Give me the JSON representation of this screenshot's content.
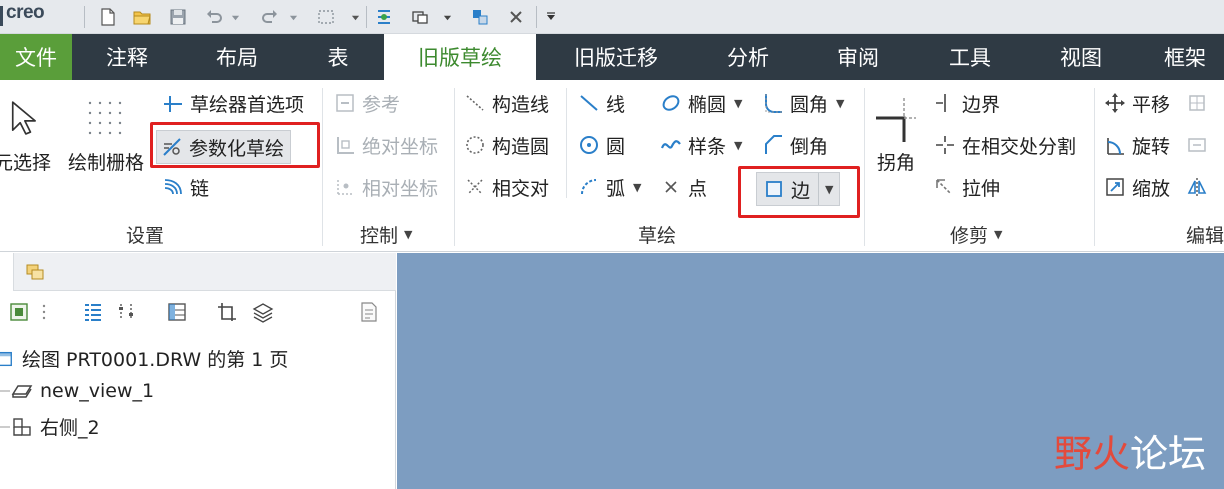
{
  "app": {
    "logo": "creo"
  },
  "tabs": [
    {
      "label": "文件"
    },
    {
      "label": "注释"
    },
    {
      "label": "布局"
    },
    {
      "label": "表"
    },
    {
      "label": "旧版草绘"
    },
    {
      "label": "旧版迁移"
    },
    {
      "label": "分析"
    },
    {
      "label": "审阅"
    },
    {
      "label": "工具"
    },
    {
      "label": "视图"
    },
    {
      "label": "框架"
    }
  ],
  "ribbon": {
    "settings": {
      "label": "设置",
      "select": "元选择",
      "grid": "绘制栅格",
      "prefs": "草绘器首选项",
      "param": "参数化草绘",
      "chain": "链"
    },
    "control": {
      "label": "控制",
      "ref": "参考",
      "abs": "绝对坐标",
      "rel": "相对坐标"
    },
    "sketch": {
      "label": "草绘",
      "cline": "构造线",
      "ccircle": "构造圆",
      "intersect": "相交对",
      "line": "线",
      "circle": "圆",
      "arc": "弧",
      "ellipse": "椭圆",
      "spline": "样条",
      "point": "点",
      "fillet": "圆角",
      "chamfer": "倒角",
      "edge": "边"
    },
    "trim": {
      "label": "修剪",
      "corner": "拐角",
      "boundary": "边界",
      "split": "在相交处分割",
      "stretch": "拉伸"
    },
    "edit": {
      "label": "编辑",
      "move": "平移",
      "rotate": "旋转",
      "scale": "缩放"
    }
  },
  "tree": {
    "root": "绘图 PRT0001.DRW 的第 1 页",
    "items": [
      "new_view_1",
      "右侧_2"
    ]
  },
  "watermark": {
    "part1": "野火",
    "part2": "论坛"
  },
  "colors": {
    "tabbar": "#2f3a44",
    "file_tab": "#5a9e3a",
    "active_tab_text": "#3d8a2f",
    "canvas": "#7d9dc1",
    "highlight": "#e02020",
    "icon_blue": "#2a7fc9"
  }
}
